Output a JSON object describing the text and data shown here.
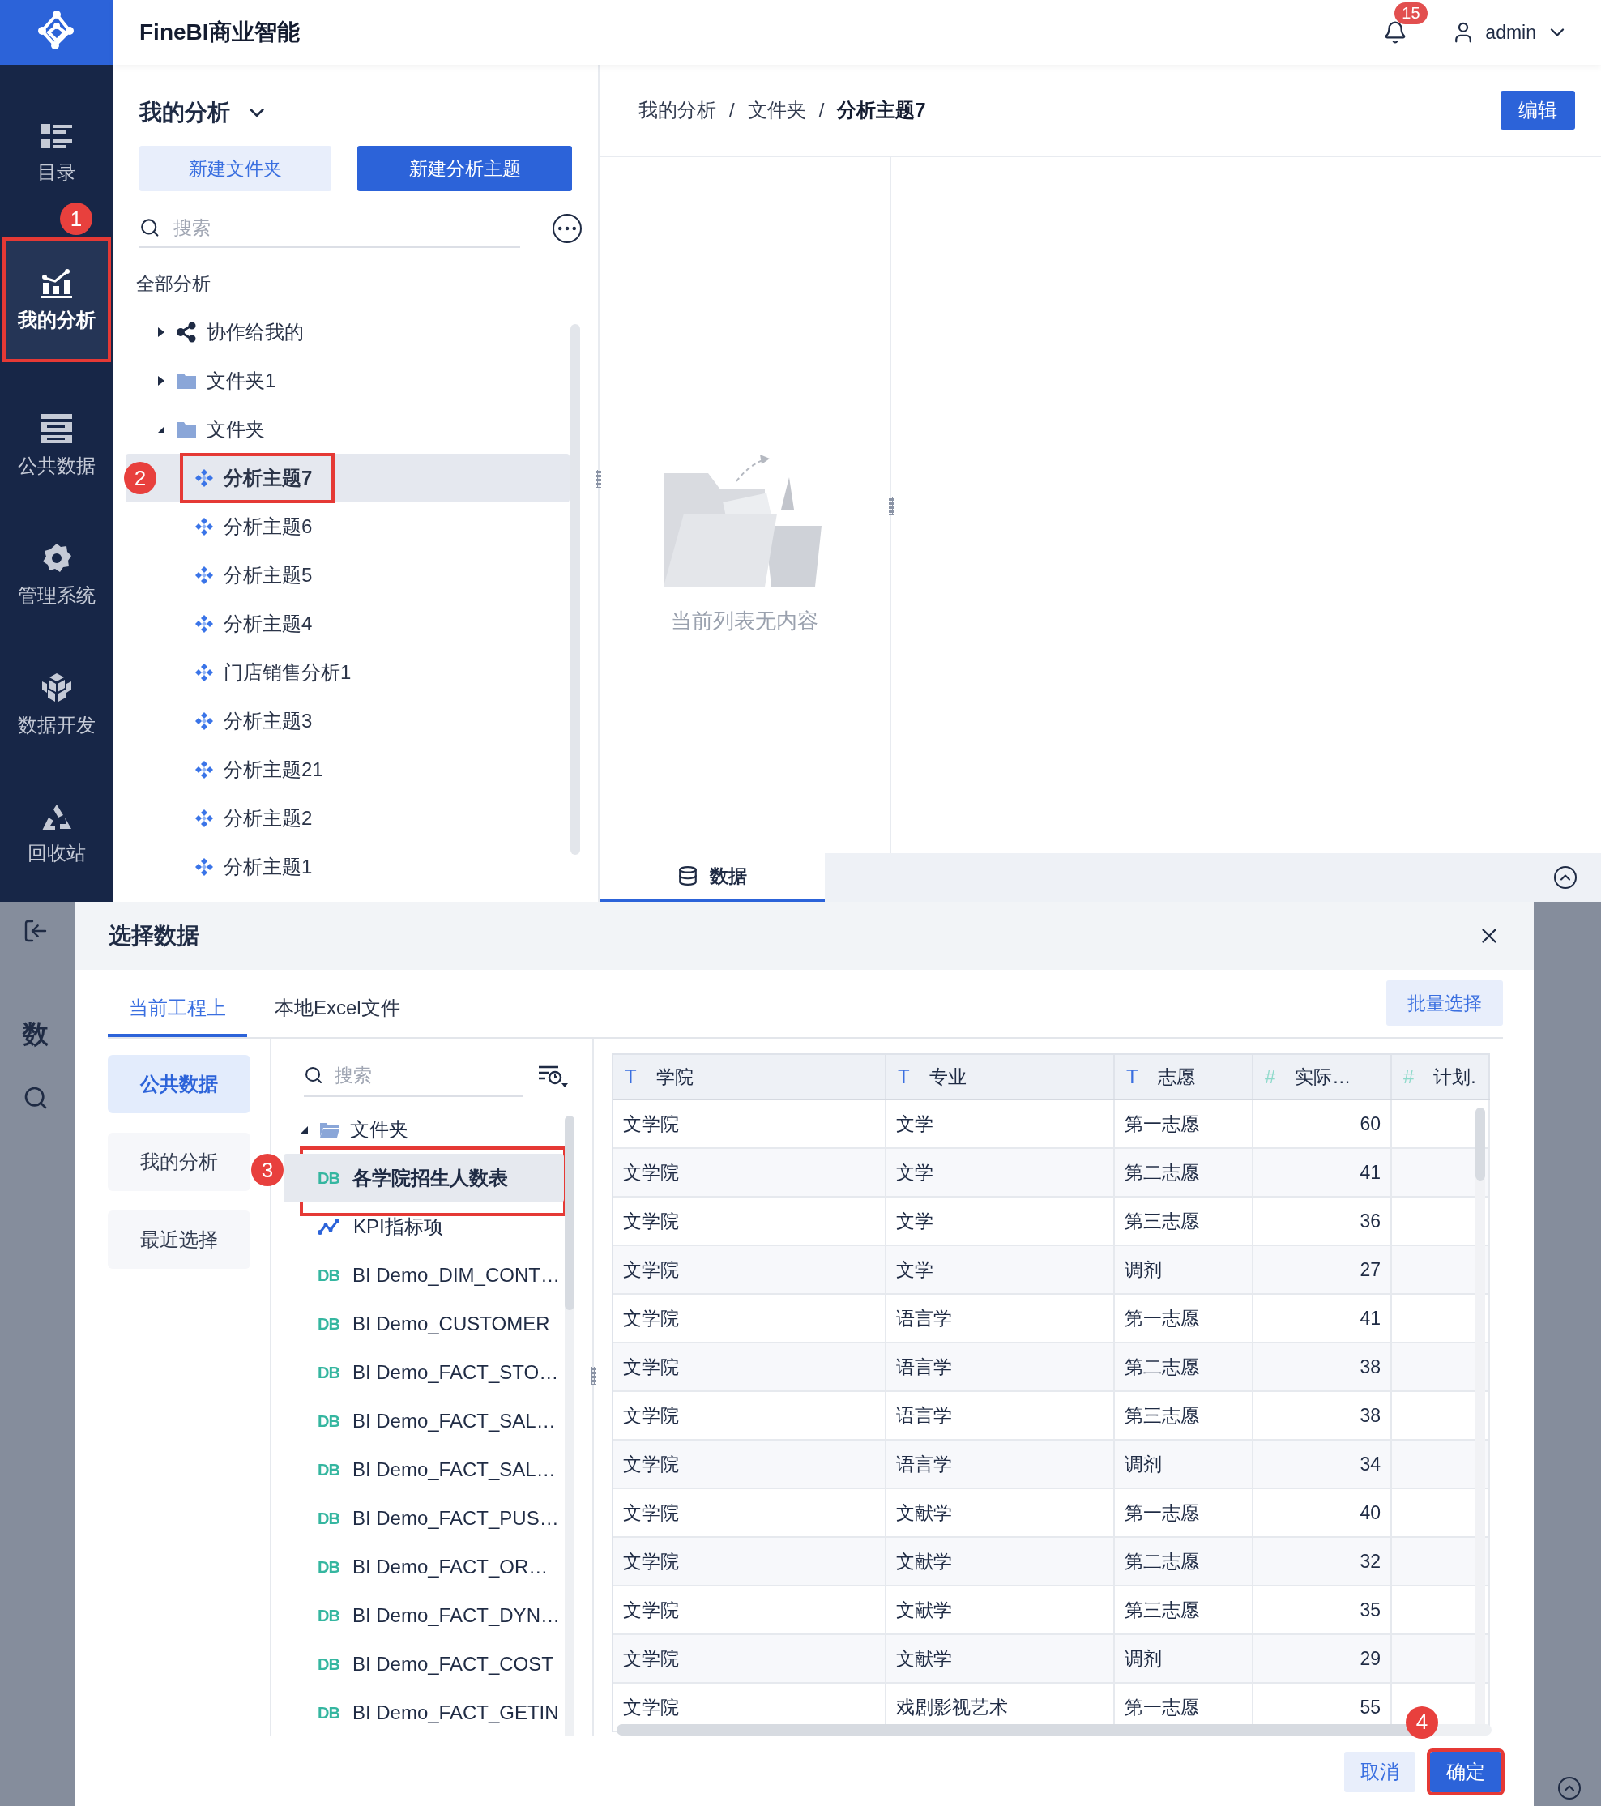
{
  "app": {
    "title": "FineBI商业智能",
    "notifications": "15",
    "user": "admin"
  },
  "sidebar": {
    "items": [
      {
        "label": "目录",
        "kind": "catalog",
        "selected": false,
        "highlighted": false
      },
      {
        "label": "我的分析",
        "kind": "analysis",
        "selected": true,
        "highlighted": true,
        "callout": "1"
      },
      {
        "label": "公共数据",
        "kind": "public",
        "selected": false,
        "highlighted": false
      },
      {
        "label": "管理系统",
        "kind": "admin",
        "selected": false,
        "highlighted": false
      },
      {
        "label": "数据开发",
        "kind": "dev",
        "selected": false,
        "highlighted": false
      },
      {
        "label": "回收站",
        "kind": "trash",
        "selected": false,
        "highlighted": false
      }
    ]
  },
  "panel": {
    "title": "我的分析",
    "buttons": [
      {
        "label": "新建文件夹",
        "kind": "secondary"
      },
      {
        "label": "新建分析主题",
        "kind": "primary"
      }
    ],
    "search": {
      "placeholder": "搜索"
    },
    "tree": [
      {
        "label": "全部分析",
        "children": [
          {
            "label": "协作给我的",
            "kind": "shared",
            "expanded": false
          },
          {
            "label": "文件夹1",
            "kind": "folder",
            "expanded": false
          },
          {
            "label": "文件夹",
            "kind": "folder",
            "expanded": true,
            "children": [
              {
                "label": "分析主题7",
                "kind": "topic",
                "selected": true,
                "highlighted": true,
                "callout": "2"
              },
              {
                "label": "分析主题6",
                "kind": "topic",
                "selected": false,
                "highlighted": false
              },
              {
                "label": "分析主题5",
                "kind": "topic",
                "selected": false,
                "highlighted": false
              },
              {
                "label": "分析主题4",
                "kind": "topic",
                "selected": false,
                "highlighted": false
              },
              {
                "label": "门店销售分析1",
                "kind": "topic",
                "selected": false,
                "highlighted": false
              },
              {
                "label": "分析主题3",
                "kind": "topic",
                "selected": false,
                "highlighted": false
              },
              {
                "label": "分析主题21",
                "kind": "topic",
                "selected": false,
                "highlighted": false
              },
              {
                "label": "分析主题2",
                "kind": "topic",
                "selected": false,
                "highlighted": false
              },
              {
                "label": "分析主题1",
                "kind": "topic",
                "selected": false,
                "highlighted": false
              }
            ]
          }
        ]
      }
    ]
  },
  "content": {
    "breadcrumb": {
      "items": [
        "我的分析",
        "文件夹",
        "分析主题7"
      ],
      "separator": "/"
    },
    "edit_button": "编辑",
    "empty_text": "当前列表无内容",
    "bottom_tabs": [
      {
        "label": "数据",
        "selected": true
      }
    ]
  },
  "background_page": {
    "heading": "数"
  },
  "dialog": {
    "title": "选择数据",
    "tabs": [
      {
        "label": "当前工程上",
        "selected": true
      },
      {
        "label": "本地Excel文件",
        "selected": false
      }
    ],
    "batch_button": "批量选择",
    "nav": [
      {
        "label": "公共数据",
        "selected": true
      },
      {
        "label": "我的分析",
        "selected": false
      },
      {
        "label": "最近选择",
        "selected": false
      }
    ],
    "search": {
      "placeholder": "搜索"
    },
    "folder": {
      "label": "文件夹",
      "expanded": true,
      "children": [
        {
          "label": "各学院招生人数表",
          "kind": "table",
          "badge": "DB",
          "selected": true,
          "highlighted": true,
          "callout": "3"
        },
        {
          "label": "KPI指标项",
          "kind": "indicator",
          "selected": false,
          "highlighted": false
        },
        {
          "label": "BI Demo_DIM_CONT…",
          "kind": "table",
          "badge": "DB",
          "selected": false,
          "highlighted": false
        },
        {
          "label": "BI Demo_CUSTOMER",
          "kind": "table",
          "badge": "DB",
          "selected": false,
          "highlighted": false
        },
        {
          "label": "BI Demo_FACT_STO…",
          "kind": "table",
          "badge": "DB",
          "selected": false,
          "highlighted": false
        },
        {
          "label": "BI Demo_FACT_SAL…",
          "kind": "table",
          "badge": "DB",
          "selected": false,
          "highlighted": false
        },
        {
          "label": "BI Demo_FACT_SAL…",
          "kind": "table",
          "badge": "DB",
          "selected": false,
          "highlighted": false
        },
        {
          "label": "BI Demo_FACT_PUS…",
          "kind": "table",
          "badge": "DB",
          "selected": false,
          "highlighted": false
        },
        {
          "label": "BI Demo_FACT_OR…",
          "kind": "table",
          "badge": "DB",
          "selected": false,
          "highlighted": false
        },
        {
          "label": "BI Demo_FACT_DYN…",
          "kind": "table",
          "badge": "DB",
          "selected": false,
          "highlighted": false
        },
        {
          "label": "BI Demo_FACT_COST",
          "kind": "table",
          "badge": "DB",
          "selected": false,
          "highlighted": false
        },
        {
          "label": "BI Demo_FACT_GETIN",
          "kind": "table",
          "badge": "DB",
          "selected": false,
          "highlighted": false
        }
      ]
    },
    "table": {
      "columns": [
        {
          "label": "学院",
          "kind": "text",
          "mark": "T"
        },
        {
          "label": "专业",
          "kind": "text",
          "mark": "T"
        },
        {
          "label": "志愿",
          "kind": "text",
          "mark": "T"
        },
        {
          "label": "实际…",
          "kind": "number",
          "mark": "#"
        },
        {
          "label": "计划.",
          "kind": "number",
          "mark": "#"
        }
      ],
      "rows": [
        [
          "文学院",
          "文学",
          "第一志愿",
          "60"
        ],
        [
          "文学院",
          "文学",
          "第二志愿",
          "41"
        ],
        [
          "文学院",
          "文学",
          "第三志愿",
          "36"
        ],
        [
          "文学院",
          "文学",
          "调剂",
          "27"
        ],
        [
          "文学院",
          "语言学",
          "第一志愿",
          "41"
        ],
        [
          "文学院",
          "语言学",
          "第二志愿",
          "38"
        ],
        [
          "文学院",
          "语言学",
          "第三志愿",
          "38"
        ],
        [
          "文学院",
          "语言学",
          "调剂",
          "34"
        ],
        [
          "文学院",
          "文献学",
          "第一志愿",
          "40"
        ],
        [
          "文学院",
          "文献学",
          "第二志愿",
          "32"
        ],
        [
          "文学院",
          "文献学",
          "第三志愿",
          "35"
        ],
        [
          "文学院",
          "文献学",
          "调剂",
          "29"
        ],
        [
          "文学院",
          "戏剧影视艺术",
          "第一志愿",
          "55"
        ]
      ]
    },
    "footer_buttons": [
      {
        "label": "取消",
        "kind": "cancel",
        "highlighted": false
      },
      {
        "label": "确定",
        "kind": "confirm",
        "highlighted": true,
        "callout": "4"
      }
    ]
  }
}
